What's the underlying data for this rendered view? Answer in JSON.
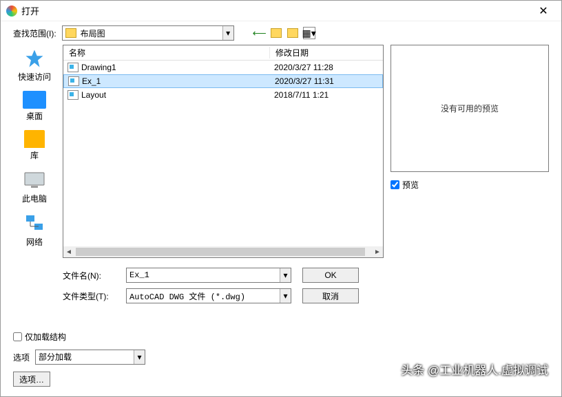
{
  "title": "打开",
  "lookin_label": "查找范围(I):",
  "current_folder": "布局图",
  "places": {
    "quick": "快速访问",
    "desktop": "桌面",
    "library": "库",
    "thispc": "此电脑",
    "network": "网络"
  },
  "columns": {
    "name": "名称",
    "date": "修改日期"
  },
  "files": [
    {
      "name": "Drawing1",
      "date": "2020/3/27 11:28"
    },
    {
      "name": "Ex_1",
      "date": "2020/3/27 11:31"
    },
    {
      "name": "Layout",
      "date": "2018/7/11 1:21"
    }
  ],
  "selected_index": 1,
  "filename_label": "文件名(N):",
  "filename_value": "Ex_1",
  "filetype_label": "文件类型(T):",
  "filetype_value": "AutoCAD DWG 文件 (*.dwg)",
  "ok": "OK",
  "cancel": "取消",
  "preview_empty": "没有可用的预览",
  "preview_chk": "预览",
  "load_struct_chk": "仅加载结构",
  "options_label": "选项",
  "options_value": "部分加载",
  "options_btn": "选项…",
  "watermark": "头条 @工业机器人.虚拟调试"
}
